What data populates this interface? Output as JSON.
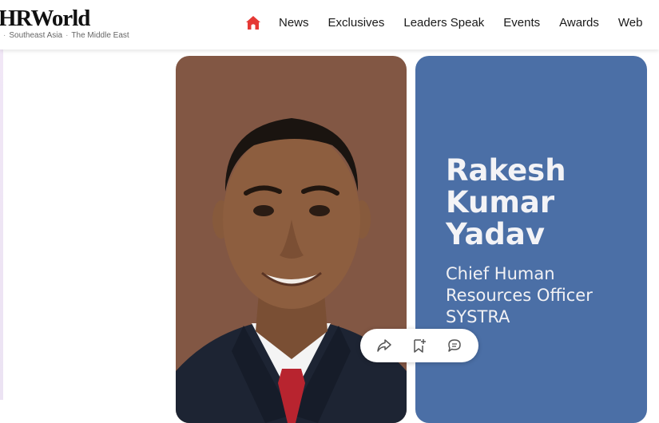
{
  "header": {
    "logo_text": "HRWorld",
    "regions": [
      "Southeast Asia",
      "The Middle East"
    ],
    "nav": [
      "News",
      "Exclusives",
      "Leaders Speak",
      "Events",
      "Awards",
      "Web"
    ]
  },
  "colors": {
    "brand_red": "#e53935",
    "photo_card_bg": "#825744",
    "info_card_bg": "#4b6fa6",
    "text_light": "#f3f3f6"
  },
  "profile": {
    "name_lines": [
      "Rakesh",
      "Kumar",
      "Yadav"
    ],
    "title_lines": [
      "Chief Human",
      "Resources Officer"
    ],
    "company": "SYSTRA"
  },
  "icons": {
    "home": "home-icon",
    "share": "share-icon",
    "bookmark": "bookmark-add-icon",
    "comment": "comment-icon"
  }
}
